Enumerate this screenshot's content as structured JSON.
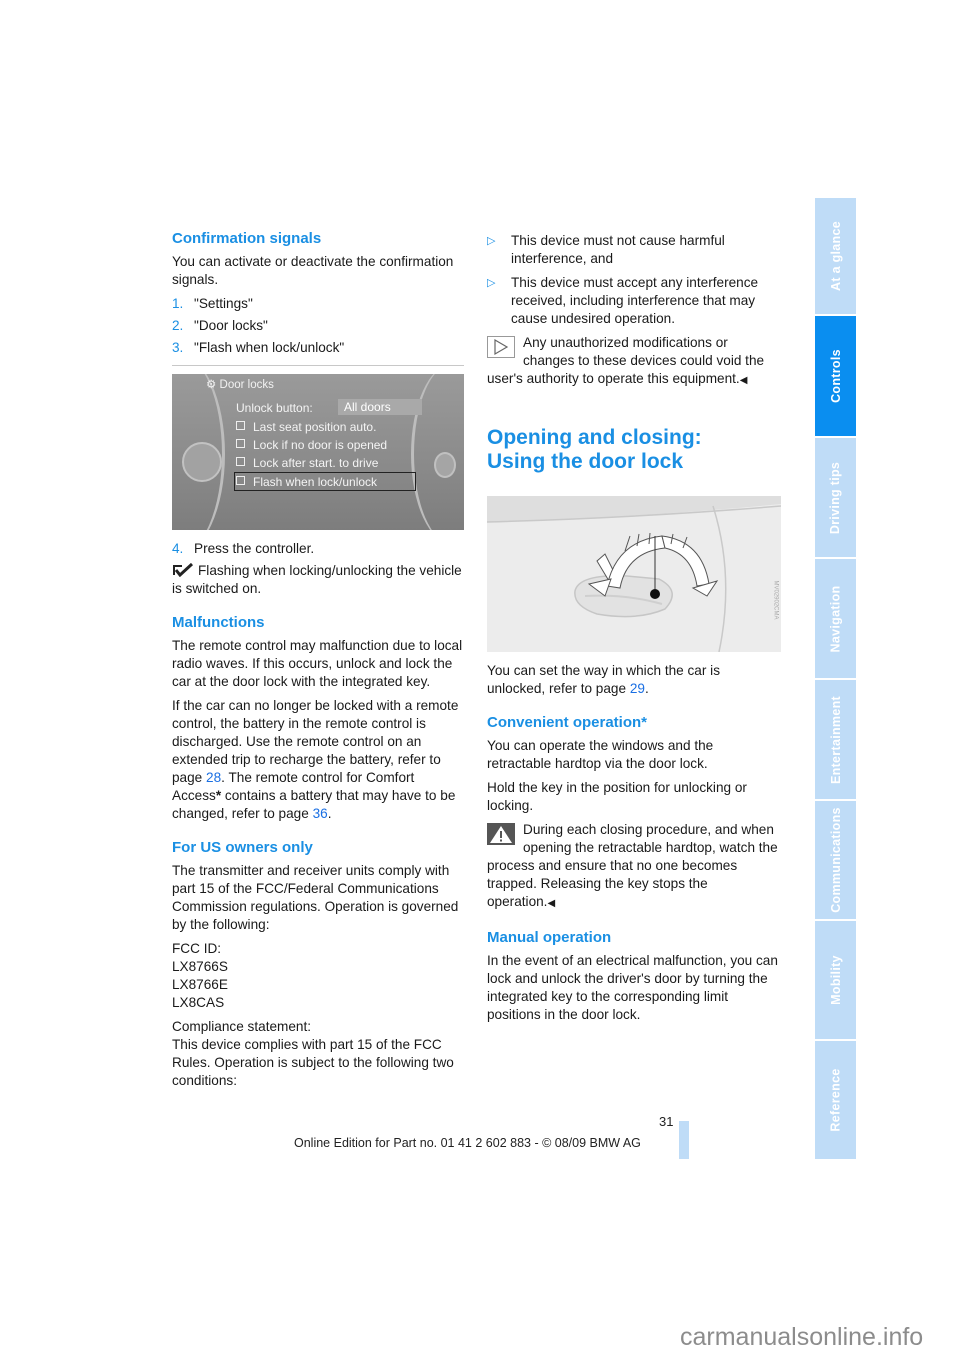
{
  "left": {
    "confirmation": {
      "heading": "Confirmation signals",
      "intro": "You can activate or deactivate the confirmation signals.",
      "steps": [
        {
          "num": "1.",
          "text": "\"Settings\""
        },
        {
          "num": "2.",
          "text": "\"Door locks\""
        },
        {
          "num": "3.",
          "text": "\"Flash when lock/unlock\""
        }
      ],
      "screen": {
        "title": "Door locks",
        "unlock_label": "Unlock button:",
        "unlock_value": "All doors",
        "options": [
          "Last seat position auto.",
          "Lock if no door is opened",
          "Lock after start. to drive",
          "Flash when lock/unlock"
        ]
      },
      "step4": {
        "num": "4.",
        "text": "Press the controller."
      },
      "result": "Flashing when locking/unlocking the vehicle is switched on."
    },
    "malfunctions": {
      "heading": "Malfunctions",
      "p1": "The remote control may malfunction due to local radio waves. If this occurs, unlock and lock the car at the door lock with the integrated key.",
      "p2_a": "If the car can no longer be locked with a remote control, the battery in the remote control is discharged. Use the remote control on an extended trip to recharge the battery, refer to page ",
      "p2_link1": "28",
      "p2_b": ". The remote control for Comfort Access",
      "p2_star": "*",
      "p2_c": " contains a battery that may have to be changed, refer to page ",
      "p2_link2": "36",
      "p2_d": "."
    },
    "us_owners": {
      "heading": "For US owners only",
      "p1": "The transmitter and receiver units comply with part 15 of the FCC/Federal Communications Commission regulations. Operation is governed by the following:",
      "fcc_label": "FCC ID:",
      "fcc_ids": [
        "LX8766S",
        "LX8766E",
        "LX8CAS"
      ],
      "compliance_label": "Compliance statement:",
      "compliance_text": "This device complies with part 15 of the FCC Rules. Operation is subject to the following two conditions:"
    }
  },
  "right": {
    "conditions": [
      "This device must not cause harmful interference, and",
      "This device must accept any interference received, including interference that may cause undesired operation."
    ],
    "note": "Any unauthorized modifications or changes to these devices could void the user's authority to operate this equipment.",
    "end_mark": "◀",
    "main_heading_line1": "Opening and closing:",
    "main_heading_line2": "Using the door lock",
    "door_image_code": "MV02902CMA",
    "intro_a": "You can set the way in which the car is unlocked, refer to page ",
    "intro_link": "29",
    "intro_b": ".",
    "convenient": {
      "heading": "Convenient operation*",
      "p1": "You can operate the windows and the retractable hardtop via the door lock.",
      "p2": "Hold the key in the position for unlocking or locking.",
      "warning": "During each closing procedure, and when opening the retractable hardtop, watch the process and ensure that no one becomes trapped. Releasing the key stops the operation."
    },
    "manual": {
      "heading": "Manual operation",
      "p1": "In the event of an electrical malfunction, you can lock and unlock the driver's door by turning the integrated key to the corresponding limit positions in the door lock."
    }
  },
  "sidebar": {
    "tabs": [
      {
        "label": "At a glance",
        "active": false
      },
      {
        "label": "Controls",
        "active": true
      },
      {
        "label": "Driving tips",
        "active": false
      },
      {
        "label": "Navigation",
        "active": false
      },
      {
        "label": "Entertainment",
        "active": false
      },
      {
        "label": "Communications",
        "active": false
      },
      {
        "label": "Mobility",
        "active": false
      },
      {
        "label": "Reference",
        "active": false
      }
    ]
  },
  "footer": {
    "page_number": "31",
    "edition": "Online Edition for Part no. 01 41 2 602 883 - © 08/09 BMW AG"
  },
  "watermark": "carmanualsonline.info",
  "colors": {
    "accent": "#1a8fe3",
    "tab_active": "#0a8ef0",
    "tab_inactive": "#bfdcf7",
    "link": "#1a6fe3"
  }
}
